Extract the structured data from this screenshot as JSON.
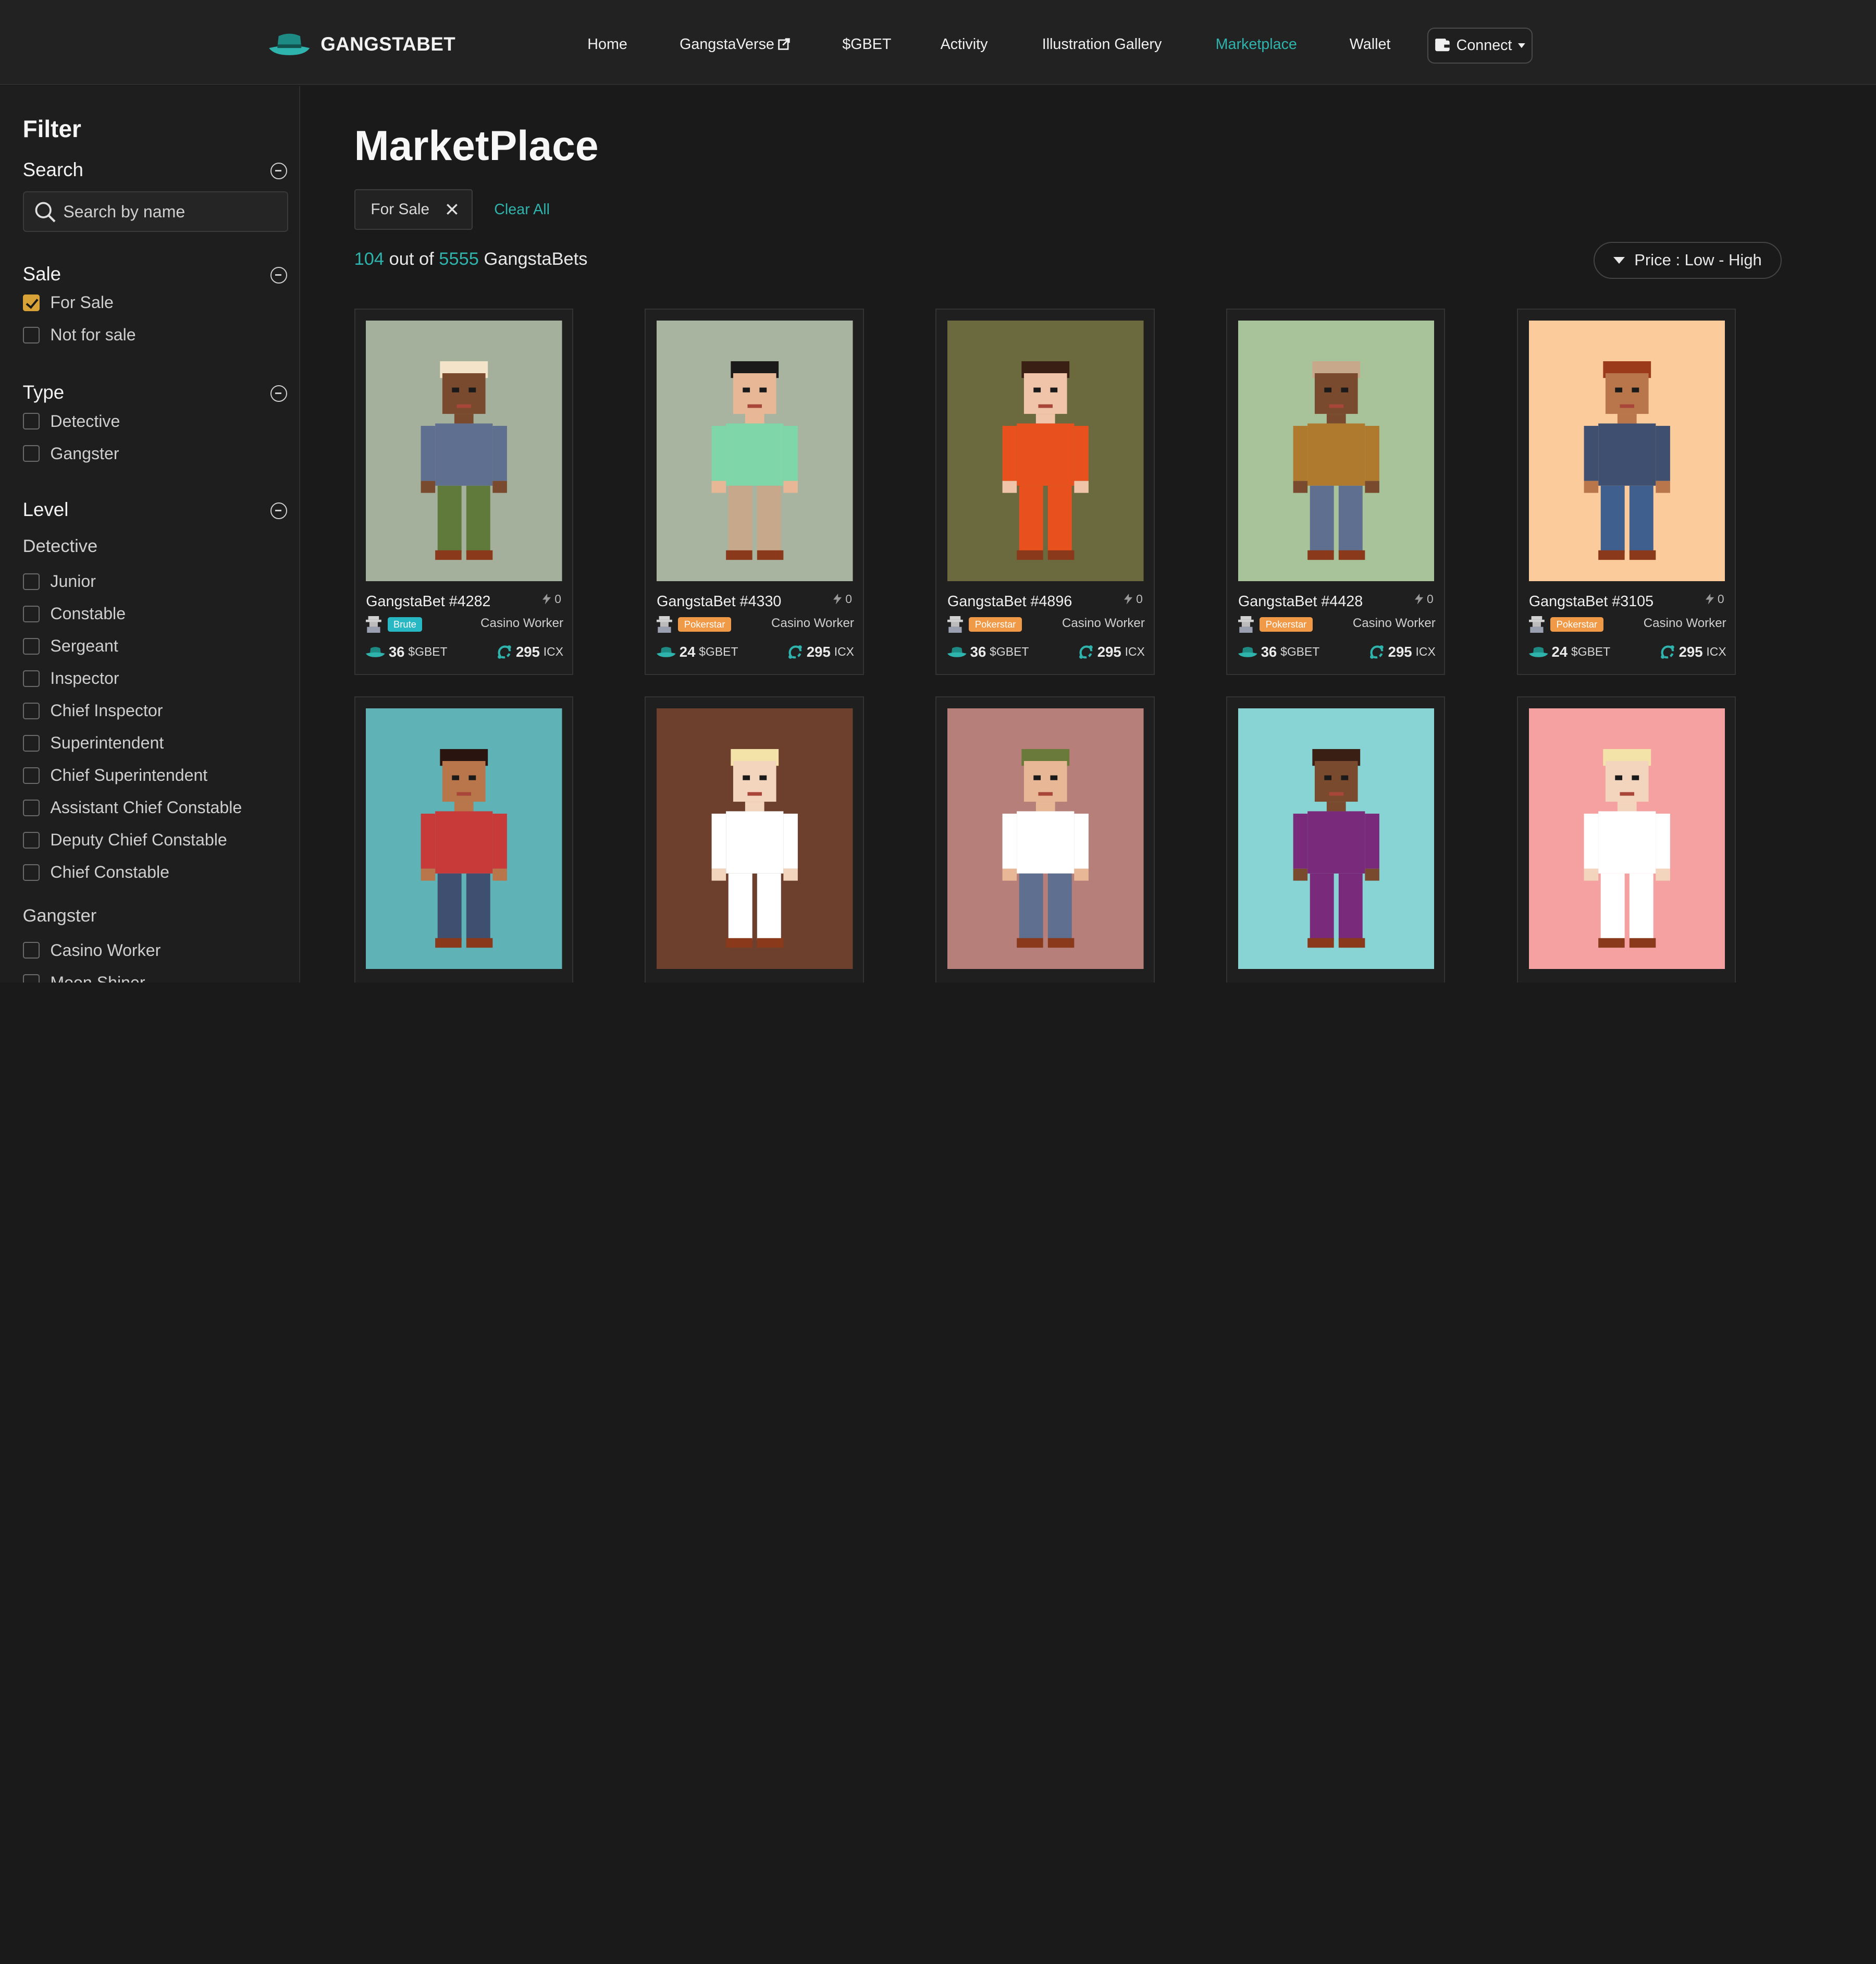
{
  "brand": {
    "name": "GANGSTABET"
  },
  "nav": {
    "items": [
      "Home",
      "GangstaVerse",
      "$GBET",
      "Activity",
      "Illustration Gallery",
      "Marketplace",
      "Wallet"
    ],
    "active": "Marketplace",
    "connect_label": "Connect"
  },
  "sidebar": {
    "title": "Filter",
    "search": {
      "heading": "Search",
      "placeholder": "Search by name"
    },
    "sale": {
      "heading": "Sale",
      "options": [
        {
          "label": "For Sale",
          "checked": true
        },
        {
          "label": "Not for sale",
          "checked": false
        }
      ]
    },
    "type": {
      "heading": "Type",
      "options": [
        {
          "label": "Detective",
          "checked": false
        },
        {
          "label": "Gangster",
          "checked": false
        }
      ]
    },
    "level": {
      "heading": "Level",
      "detective_heading": "Detective",
      "detective_levels": [
        "Junior",
        "Constable",
        "Sergeant",
        "Inspector",
        "Chief Inspector",
        "Superintendent",
        "Chief Superintendent",
        "Assistant Chief Constable",
        "Deputy Chief Constable",
        "Chief Constable"
      ],
      "gangster_heading": "Gangster",
      "gangster_levels": [
        "Casino Worker",
        "Moon Shiner"
      ]
    }
  },
  "main": {
    "title": "MarketPlace",
    "active_filter_chip": "For Sale",
    "clear_all": "Clear All",
    "count": {
      "shown": "104",
      "out_of": "out of",
      "total": "5555",
      "suffix": "GangstaBets"
    },
    "sort_label": "Price : Low - High"
  },
  "cards": [
    {
      "name": "GangstaBet #4282",
      "likes": "0",
      "badge": "Brute",
      "badge_color": "#27b8c4",
      "role": "Casino Worker",
      "gbet": "36",
      "gbet_unit": "$GBET",
      "icx": "295",
      "icx_unit": "ICX",
      "bg": "#a5b09c"
    },
    {
      "name": "GangstaBet #4330",
      "likes": "0",
      "badge": "Pokerstar",
      "badge_color": "#f09a47",
      "role": "Casino Worker",
      "gbet": "24",
      "gbet_unit": "$GBET",
      "icx": "295",
      "icx_unit": "ICX",
      "bg": "#a8b4a0"
    },
    {
      "name": "GangstaBet #4896",
      "likes": "0",
      "badge": "Pokerstar",
      "badge_color": "#f09a47",
      "role": "Casino Worker",
      "gbet": "36",
      "gbet_unit": "$GBET",
      "icx": "295",
      "icx_unit": "ICX",
      "bg": "#6b6a3e"
    },
    {
      "name": "GangstaBet #4428",
      "likes": "0",
      "badge": "Pokerstar",
      "badge_color": "#f09a47",
      "role": "Casino Worker",
      "gbet": "36",
      "gbet_unit": "$GBET",
      "icx": "295",
      "icx_unit": "ICX",
      "bg": "#a8c39a"
    },
    {
      "name": "GangstaBet #3105",
      "likes": "0",
      "badge": "Pokerstar",
      "badge_color": "#f09a47",
      "role": "Casino Worker",
      "gbet": "24",
      "gbet_unit": "$GBET",
      "icx": "295",
      "icx_unit": "ICX",
      "bg": "#fccb9b"
    },
    {
      "name": "",
      "likes": "",
      "badge": "",
      "badge_color": "",
      "role": "",
      "gbet": "",
      "gbet_unit": "",
      "icx": "",
      "icx_unit": "",
      "bg": "#5fb2b6"
    },
    {
      "name": "",
      "likes": "",
      "badge": "",
      "badge_color": "",
      "role": "",
      "gbet": "",
      "gbet_unit": "",
      "icx": "",
      "icx_unit": "",
      "bg": "#6c402c"
    },
    {
      "name": "",
      "likes": "",
      "badge": "",
      "badge_color": "",
      "role": "",
      "gbet": "",
      "gbet_unit": "",
      "icx": "",
      "icx_unit": "",
      "bg": "#b77f79"
    },
    {
      "name": "",
      "likes": "",
      "badge": "",
      "badge_color": "",
      "role": "",
      "gbet": "",
      "gbet_unit": "",
      "icx": "",
      "icx_unit": "",
      "bg": "#88d4d4"
    },
    {
      "name": "",
      "likes": "",
      "badge": "",
      "badge_color": "",
      "role": "",
      "gbet": "",
      "gbet_unit": "",
      "icx": "",
      "icx_unit": "",
      "bg": "#f5a1a1"
    }
  ]
}
